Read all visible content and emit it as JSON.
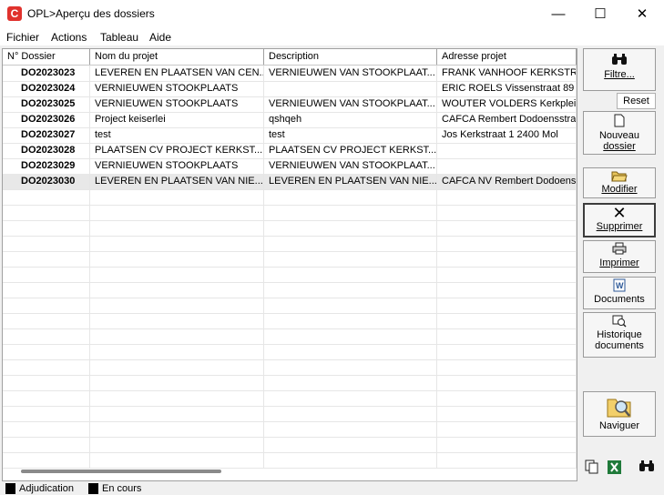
{
  "window": {
    "title": "OPL>Aperçu des dossiers",
    "logo": "C"
  },
  "controls": {
    "minimize": "—",
    "maximize": "☐",
    "close": "✕"
  },
  "menu": [
    "Fichier",
    "Actions",
    "Tableau",
    "Aide"
  ],
  "columns": [
    "N° Dossier",
    "Nom du projet",
    "Description",
    "Adresse projet"
  ],
  "rows": [
    [
      "DO2023023",
      "LEVEREN EN PLAATSEN VAN CEN...",
      "VERNIEUWEN VAN STOOKPLAAT...",
      "FRANK VANHOOF KERKSTRA"
    ],
    [
      "DO2023024",
      "VERNIEUWEN STOOKPLAATS",
      "",
      "ERIC ROELS Vissenstraat 89 3"
    ],
    [
      "DO2023025",
      "VERNIEUWEN STOOKPLAATS",
      "VERNIEUWEN VAN STOOKPLAAT...",
      "WOUTER VOLDERS Kerkplein"
    ],
    [
      "DO2023026",
      "Project keiserlei",
      "qshqeh",
      "CAFCA Rembert Dodoensstraa"
    ],
    [
      "DO2023027",
      "test",
      "test",
      "Jos Kerkstraat 1 2400 Mol"
    ],
    [
      "DO2023028",
      "PLAATSEN CV PROJECT KERKST...",
      "PLAATSEN CV PROJECT KERKST...",
      ""
    ],
    [
      "DO2023029",
      "VERNIEUWEN STOOKPLAATS",
      "VERNIEUWEN VAN STOOKPLAAT...",
      ""
    ],
    [
      "DO2023030",
      "LEVEREN EN PLAATSEN VAN NIE...",
      "LEVEREN EN PLAATSEN VAN NIE...",
      "CAFCA NV Rembert Dodoenss"
    ]
  ],
  "sidebar": {
    "filter": "Filtre...",
    "reset": "Reset",
    "new_line1": "Nouveau",
    "new_line2": "dossier",
    "modify": "Modifier",
    "delete": "Supprimer",
    "print": "Imprimer",
    "documents": "Documents",
    "history_line1": "Historique",
    "history_line2": "documents",
    "navigate": "Naviguer"
  },
  "legend": [
    "Adjudication",
    "En cours"
  ],
  "icons": {
    "binoculars": "binoculars-icon",
    "new": "new-document-icon",
    "folder": "open-folder-icon",
    "delete": "delete-x-icon",
    "print": "printer-icon",
    "word": "word-document-icon",
    "history": "history-icon",
    "navigate": "folder-magnifier-icon",
    "copy": "copy-icon",
    "excel": "excel-icon"
  },
  "colors": {
    "logo": "#e0322d",
    "selected_row": "#e8e8e8",
    "excel": "#1f7a3a",
    "word": "#2b5797"
  }
}
